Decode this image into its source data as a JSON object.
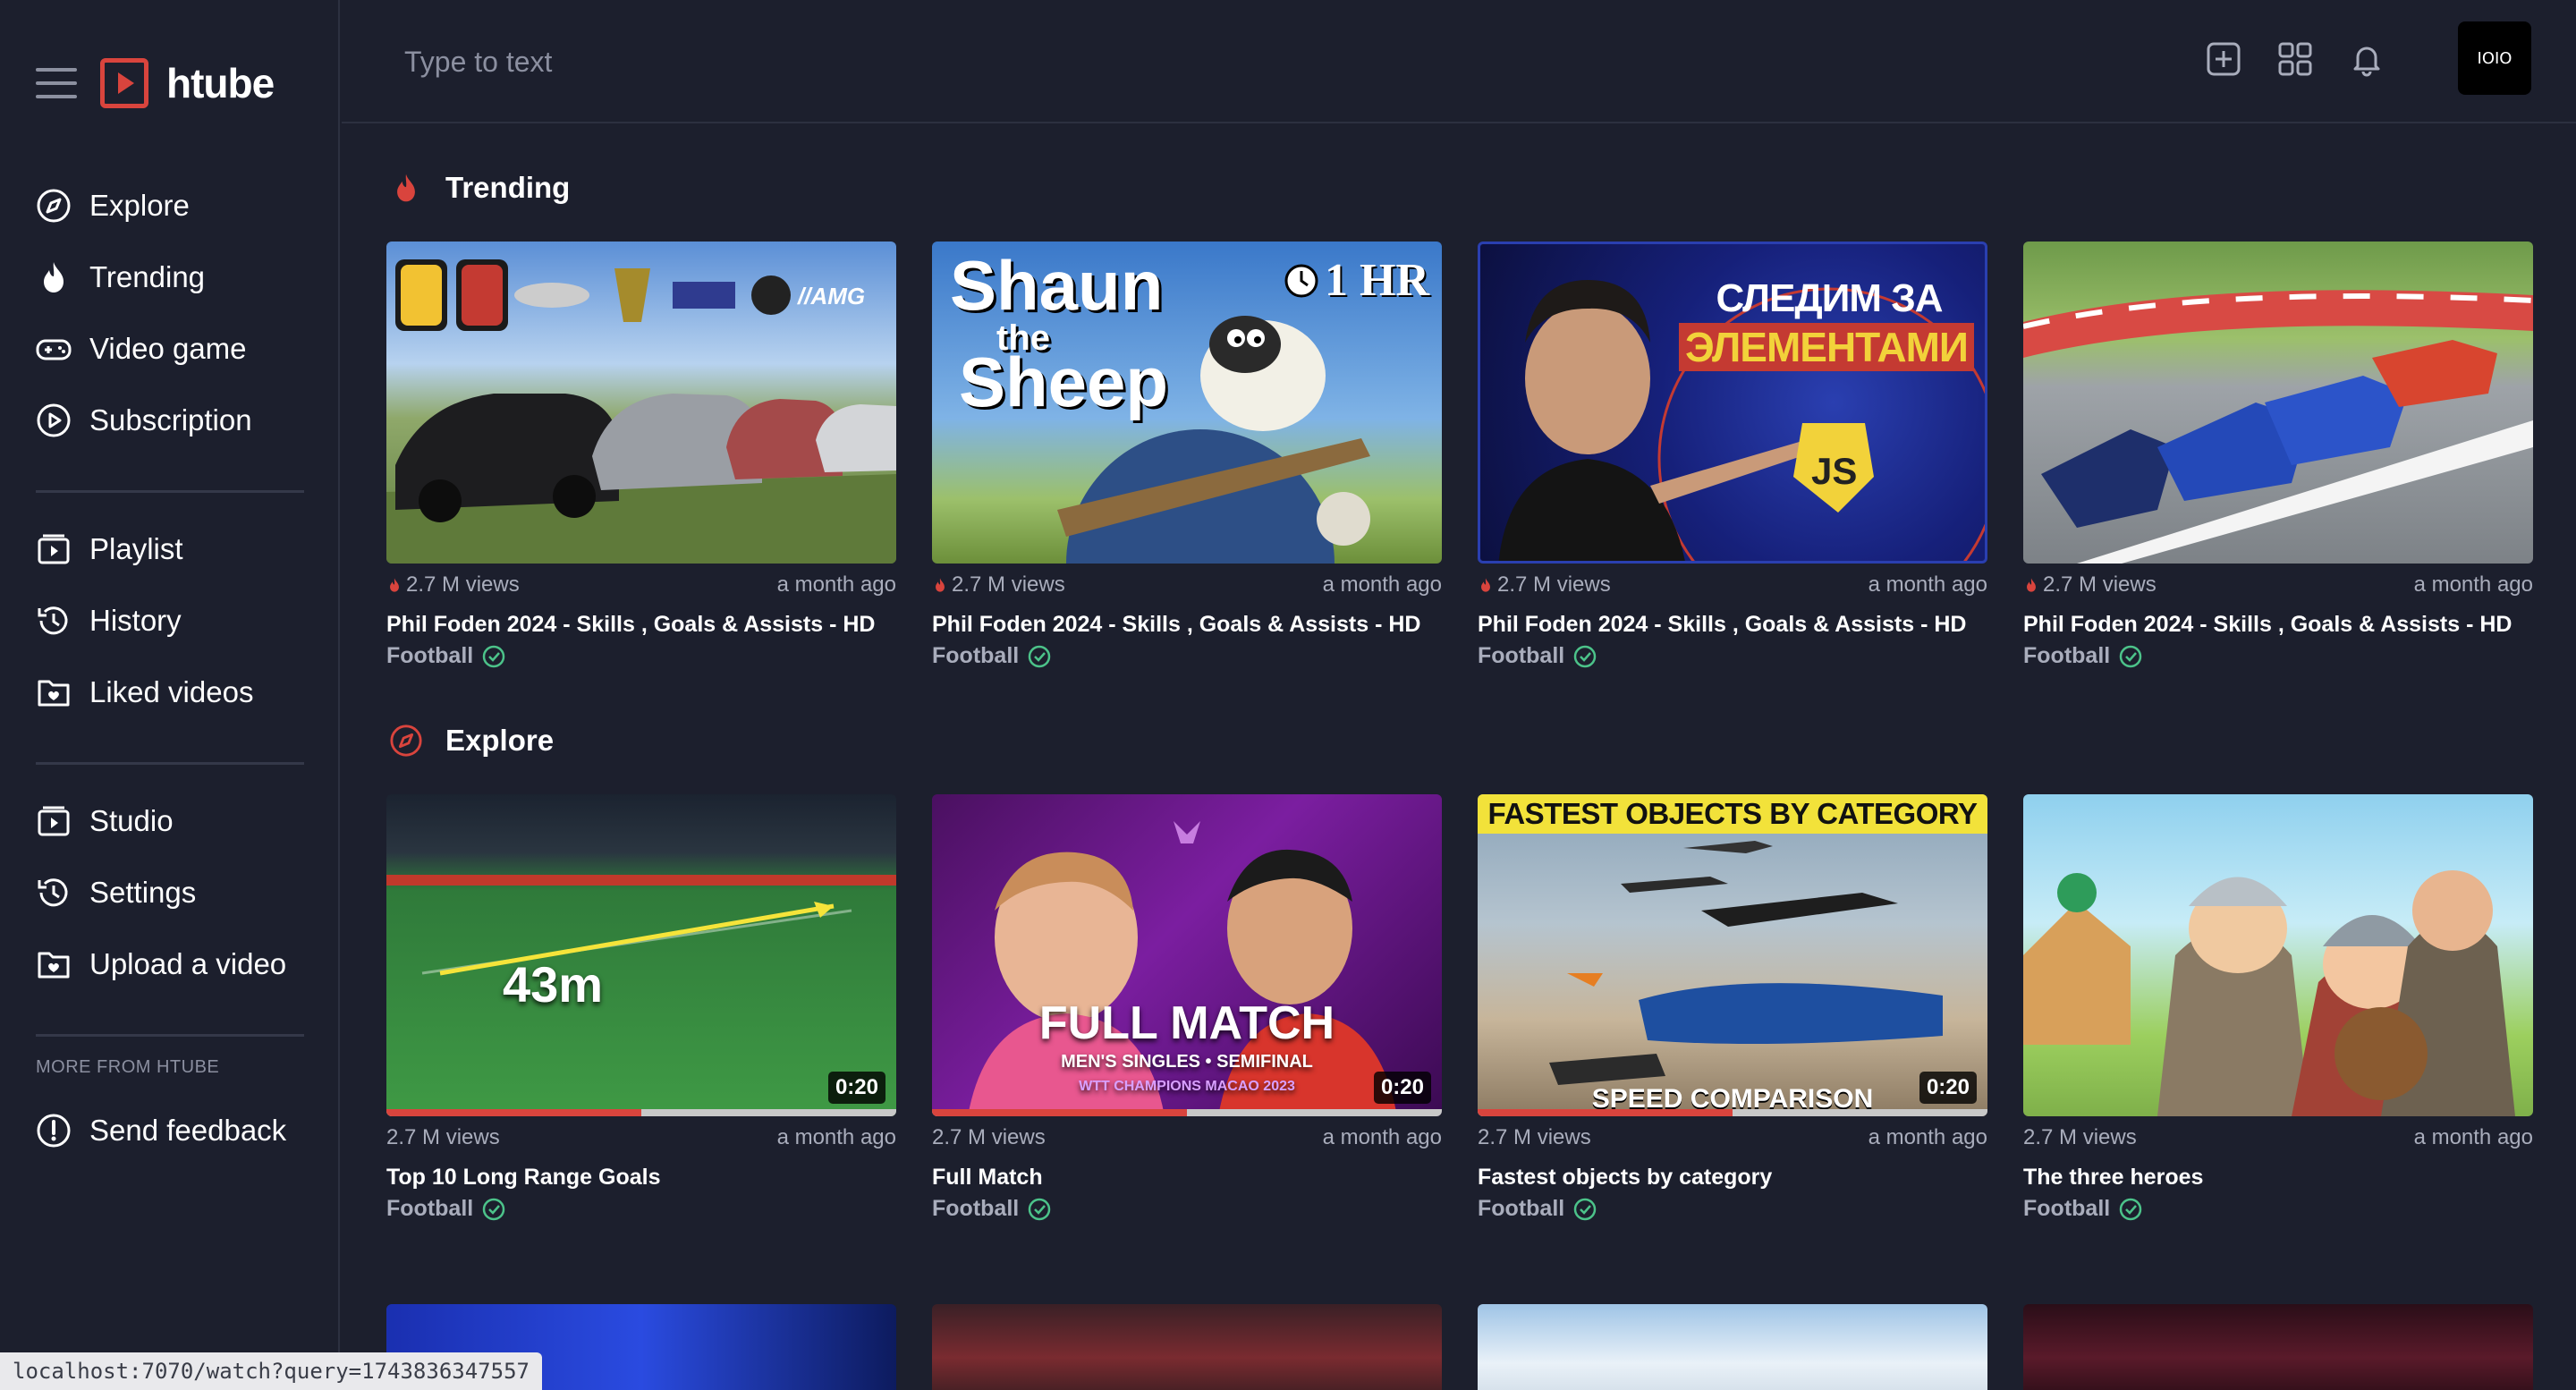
{
  "app": {
    "brand_name": "htube"
  },
  "sidebar": {
    "primary": [
      {
        "label": "Explore",
        "icon": "compass-icon"
      },
      {
        "label": "Trending",
        "icon": "flame-icon"
      },
      {
        "label": "Video game",
        "icon": "gamepad-icon"
      },
      {
        "label": "Subscription",
        "icon": "play-circle-icon"
      }
    ],
    "library": [
      {
        "label": "Playlist",
        "icon": "playlist-icon"
      },
      {
        "label": "History",
        "icon": "history-icon"
      },
      {
        "label": "Liked videos",
        "icon": "folder-heart-icon"
      }
    ],
    "manage": [
      {
        "label": "Studio",
        "icon": "studio-icon"
      },
      {
        "label": "Settings",
        "icon": "settings-icon"
      },
      {
        "label": "Upload a video",
        "icon": "upload-folder-icon"
      }
    ],
    "more_label": "MORE FROM HTUBE",
    "feedback": {
      "label": "Send feedback",
      "icon": "alert-circle-icon"
    }
  },
  "topbar": {
    "search_placeholder": "Type to text",
    "avatar_text": "IOIO"
  },
  "colors": {
    "accent": "#d9443d",
    "background": "#1c1f2d",
    "check": "#4cc38a"
  },
  "sections": {
    "trending": {
      "title": "Trending",
      "videos": [
        {
          "views": "2.7 M views",
          "age": "a month ago",
          "title": "Phil Foden 2024 - Skills , Goals & Assists - HD",
          "channel": "Football"
        },
        {
          "views": "2.7 M views",
          "age": "a month ago",
          "title": "Phil Foden 2024 - Skills , Goals & Assists - HD",
          "channel": "Football",
          "thumb_text_1": "Shaun",
          "thumb_text_2": "the",
          "thumb_text_3": "Sheep",
          "thumb_badge": "1 HR"
        },
        {
          "views": "2.7 M views",
          "age": "a month ago",
          "title": "Phil Foden 2024 - Skills , Goals & Assists - HD",
          "channel": "Football",
          "thumb_text_1": "СЛЕДИМ ЗА",
          "thumb_text_2": "ЭЛЕМЕНТАМИ",
          "thumb_badge": "JS"
        },
        {
          "views": "2.7 M views",
          "age": "a month ago",
          "title": "Phil Foden 2024 - Skills , Goals & Assists - HD",
          "channel": "Football"
        }
      ]
    },
    "explore": {
      "title": "Explore",
      "videos": [
        {
          "views": "2.7 M views",
          "age": "a month ago",
          "title": "Top 10 Long Range Goals",
          "channel": "Football",
          "duration": "0:20",
          "progress": 0.5,
          "thumb_text_1": "43m"
        },
        {
          "views": "2.7 M views",
          "age": "a month ago",
          "title": "Full Match",
          "channel": "Football",
          "duration": "0:20",
          "progress": 0.5,
          "thumb_text_1": "FULL MATCH",
          "thumb_text_2": "MEN'S SINGLES • SEMIFINAL",
          "thumb_text_3": "WTT CHAMPIONS MACAO 2023"
        },
        {
          "views": "2.7 M views",
          "age": "a month ago",
          "title": "Fastest objects by category",
          "channel": "Football",
          "duration": "0:20",
          "progress": 0.5,
          "thumb_text_1": "FASTEST OBJECTS BY CATEGORY",
          "thumb_text_2": "SPEED COMPARISON"
        },
        {
          "views": "2.7 M views",
          "age": "a month ago",
          "title": "The three heroes",
          "channel": "Football"
        }
      ]
    }
  },
  "status_url": "localhost:7070/watch?query=1743836347557"
}
